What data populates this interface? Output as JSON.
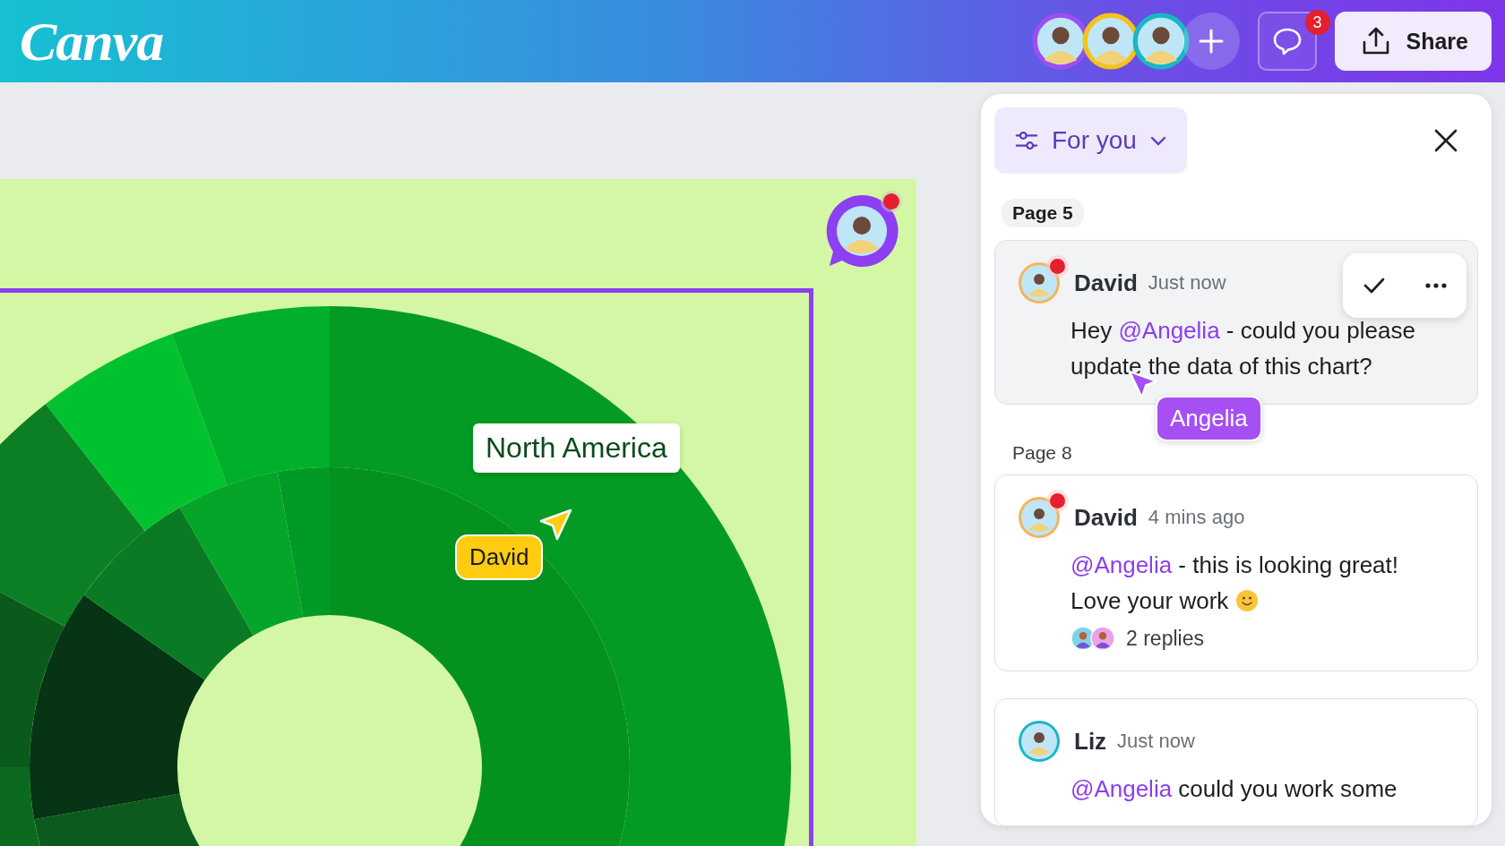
{
  "app": {
    "logo": "Canva"
  },
  "collaborators": [
    {
      "color": "#9b4ff2"
    },
    {
      "color": "#f7c21a"
    },
    {
      "color": "#1ab6c6"
    }
  ],
  "comments_button": {
    "badge": "3"
  },
  "share_button": {
    "label": "Share"
  },
  "canvas": {
    "data_label": "North America",
    "cursor": {
      "name": "David",
      "color": "#ffcc12"
    },
    "comment_pin": {
      "unread": true
    }
  },
  "panel": {
    "filter": {
      "label": "For you"
    },
    "sections": [
      {
        "page": "Page 5",
        "highlighted": true,
        "comments": [
          {
            "author": "David",
            "time": "Just now",
            "unread": true,
            "selected": true,
            "avatar": {
              "color": "#f6b35a"
            },
            "body": [
              {
                "text": "Hey "
              },
              {
                "text": "@Angelia",
                "mention": true
              },
              {
                "text": " - could you please update the data of this chart?"
              }
            ]
          }
        ]
      },
      {
        "page": "Page 8",
        "highlighted": false,
        "comments": [
          {
            "author": "David",
            "time": "4 mins ago",
            "unread": true,
            "selected": false,
            "avatar": {
              "color": "#f6b35a"
            },
            "body": [
              {
                "text": "@Angelia",
                "mention": true
              },
              {
                "text": " - this is looking great! Love your work"
              }
            ],
            "emoji": true,
            "replies": {
              "label": "2 replies",
              "avatars": [
                {
                  "color": "#7fd3e8"
                },
                {
                  "color": "#e9a3e6"
                }
              ]
            }
          },
          {
            "author": "Liz",
            "time": "Just now",
            "unread": false,
            "selected": false,
            "avatar": {
              "color": "#1ab6c6"
            },
            "body": [
              {
                "text": "@Angelia",
                "mention": true
              },
              {
                "text": " could you work some"
              }
            ]
          }
        ]
      }
    ],
    "cursor": {
      "name": "Angelia",
      "color": "#a64ff3"
    }
  }
}
